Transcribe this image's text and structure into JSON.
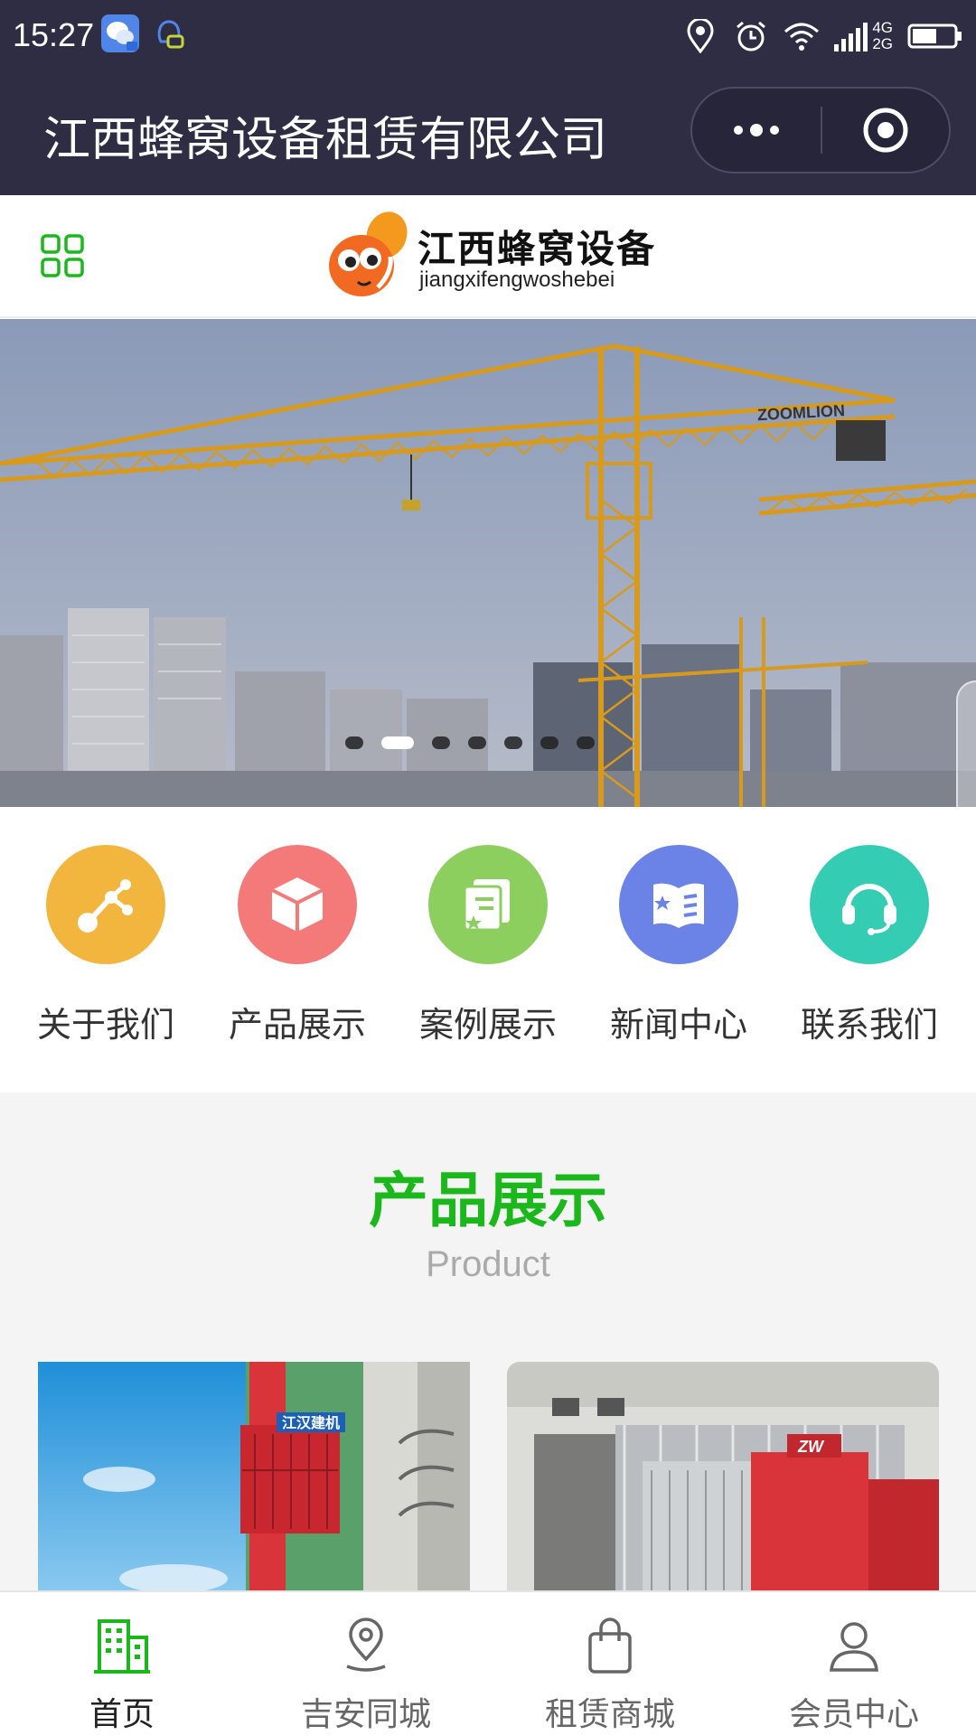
{
  "status_bar": {
    "time": "15:27",
    "network": [
      "4G",
      "2G"
    ],
    "icons": [
      "wechat-notification-icon",
      "qq-notification-icon",
      "location-icon",
      "alarm-icon",
      "wifi-icon",
      "signal-icon",
      "battery-icon"
    ]
  },
  "title_bar": {
    "title": "江西蜂窝设备租赁有限公司",
    "more_icon": "more-dots-icon",
    "close_icon": "close-target-icon"
  },
  "header": {
    "menu_icon": "grid-menu-icon",
    "logo_cn": "江西蜂窝设备",
    "logo_en": "jiangxifengwoshebei",
    "logo_color": "#f26a22"
  },
  "banner": {
    "image": "tower-crane-construction-photo",
    "crane_brand": "ZOOMLION",
    "slide_count": 7,
    "active_slide": 2
  },
  "quick_nav": [
    {
      "label": "关于我们",
      "icon": "network-nodes-icon",
      "color": "#f2b53d"
    },
    {
      "label": "产品展示",
      "icon": "cube-icon",
      "color": "#f47a7a"
    },
    {
      "label": "案例展示",
      "icon": "certificate-icon",
      "color": "#8ccf5e"
    },
    {
      "label": "新闻中心",
      "icon": "news-book-icon",
      "color": "#6b82e6"
    },
    {
      "label": "联系我们",
      "icon": "headset-icon",
      "color": "#35ccb4"
    }
  ],
  "product_section": {
    "title": "产品展示",
    "subtitle": "Product",
    "title_color": "#1bb81b",
    "cards": [
      {
        "image": "construction-hoist-photo",
        "sign_text": "江汉建机"
      },
      {
        "image": "construction-elevator-factory-photo",
        "sign_text": "ZW"
      }
    ]
  },
  "tab_bar": {
    "active_index": 0,
    "active_color": "#1bb81b",
    "tabs": [
      {
        "label": "首页",
        "icon": "building-icon"
      },
      {
        "label": "吉安同城",
        "icon": "map-pin-icon"
      },
      {
        "label": "租赁商城",
        "icon": "shopping-bag-icon"
      },
      {
        "label": "会员中心",
        "icon": "user-icon"
      }
    ]
  }
}
